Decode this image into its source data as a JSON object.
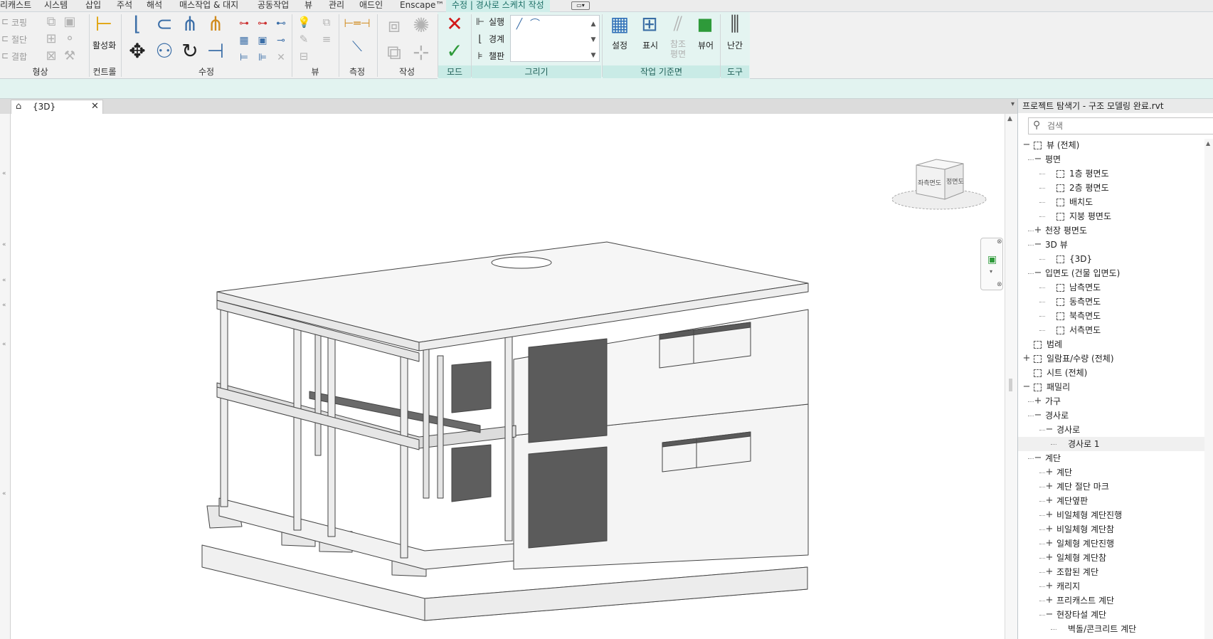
{
  "menu": {
    "tabs": [
      "리캐스트",
      "시스템",
      "삽입",
      "주석",
      "해석",
      "매스작업 & 대지",
      "공동작업",
      "뷰",
      "관리",
      "애드인",
      "Enscape™"
    ],
    "context_tab": "수정 | 경사로 스케치 작성"
  },
  "ribbon": {
    "panels": {
      "shape": "형상",
      "control": "컨트롤",
      "modify": "수정",
      "view": "뷰",
      "measure": "측정",
      "create": "작성",
      "mode": "모드",
      "draw": "그리기",
      "workplane": "작업 기준면",
      "tools": "도구"
    },
    "shape_items": [
      "코핑",
      "절단",
      "결합"
    ],
    "activate_label": "활성화",
    "draw_items": [
      "실행",
      "경계",
      "챌판"
    ],
    "workplane_items": {
      "set": "설정",
      "show": "표시",
      "ref_plane": "참조\n평면",
      "viewer": "뷰어"
    },
    "railing_label": "난간"
  },
  "view_tab": {
    "label": "{3D}"
  },
  "viewcube": {
    "left_face": "좌측면도",
    "front_face": "정면도"
  },
  "browser": {
    "title": "프로젝트 탐색기 - 구조 모델링 완료.rvt",
    "search_placeholder": "검색",
    "rows": [
      {
        "label": "뷰 (전체)",
        "toggle": "−",
        "level": 0,
        "icon": "views-icon"
      },
      {
        "label": "평면",
        "toggle": "−",
        "level": 1
      },
      {
        "label": "1층 평면도",
        "toggle": "",
        "level": 2,
        "icon": "view-icon"
      },
      {
        "label": "2층 평면도",
        "toggle": "",
        "level": 2,
        "icon": "view-icon"
      },
      {
        "label": "배치도",
        "toggle": "",
        "level": 2,
        "icon": "view-icon"
      },
      {
        "label": "지붕 평면도",
        "toggle": "",
        "level": 2,
        "icon": "view-icon"
      },
      {
        "label": "천장 평면도",
        "toggle": "+",
        "level": 1
      },
      {
        "label": "3D 뷰",
        "toggle": "−",
        "level": 1
      },
      {
        "label": "{3D}",
        "toggle": "",
        "level": 2,
        "icon": "view-icon"
      },
      {
        "label": "입면도 (건물 입면도)",
        "toggle": "−",
        "level": 1
      },
      {
        "label": "남측면도",
        "toggle": "",
        "level": 2,
        "icon": "view-icon"
      },
      {
        "label": "동측면도",
        "toggle": "",
        "level": 2,
        "icon": "view-icon"
      },
      {
        "label": "북측면도",
        "toggle": "",
        "level": 2,
        "icon": "view-icon"
      },
      {
        "label": "서측면도",
        "toggle": "",
        "level": 2,
        "icon": "view-icon"
      },
      {
        "label": "범례",
        "toggle": "",
        "level": 0,
        "icon": "legend-icon"
      },
      {
        "label": "일람표/수량 (전체)",
        "toggle": "+",
        "level": 0,
        "icon": "schedule-icon"
      },
      {
        "label": "시트 (전체)",
        "toggle": "",
        "level": 0,
        "icon": "sheet-icon"
      },
      {
        "label": "패밀리",
        "toggle": "−",
        "level": 0,
        "icon": "family-icon"
      },
      {
        "label": "가구",
        "toggle": "+",
        "level": 1
      },
      {
        "label": "경사로",
        "toggle": "−",
        "level": 1
      },
      {
        "label": "경사로",
        "toggle": "−",
        "level": 2
      },
      {
        "label": "경사로 1",
        "toggle": "",
        "level": 3,
        "selected": true
      },
      {
        "label": "계단",
        "toggle": "−",
        "level": 1
      },
      {
        "label": "계단",
        "toggle": "+",
        "level": 2
      },
      {
        "label": "계단 절단 마크",
        "toggle": "+",
        "level": 2
      },
      {
        "label": "계단옆판",
        "toggle": "+",
        "level": 2
      },
      {
        "label": "비일체형 계단진행",
        "toggle": "+",
        "level": 2
      },
      {
        "label": "비일체형 계단참",
        "toggle": "+",
        "level": 2
      },
      {
        "label": "일체형 계단진행",
        "toggle": "+",
        "level": 2
      },
      {
        "label": "일체형 계단참",
        "toggle": "+",
        "level": 2
      },
      {
        "label": "조합된 계단",
        "toggle": "+",
        "level": 2
      },
      {
        "label": "캐리지",
        "toggle": "+",
        "level": 2
      },
      {
        "label": "프리캐스트 계단",
        "toggle": "+",
        "level": 2
      },
      {
        "label": "현장타설 계단",
        "toggle": "−",
        "level": 2
      },
      {
        "label": "벽돌/콘크리트 계단",
        "toggle": "",
        "level": 3
      }
    ]
  }
}
